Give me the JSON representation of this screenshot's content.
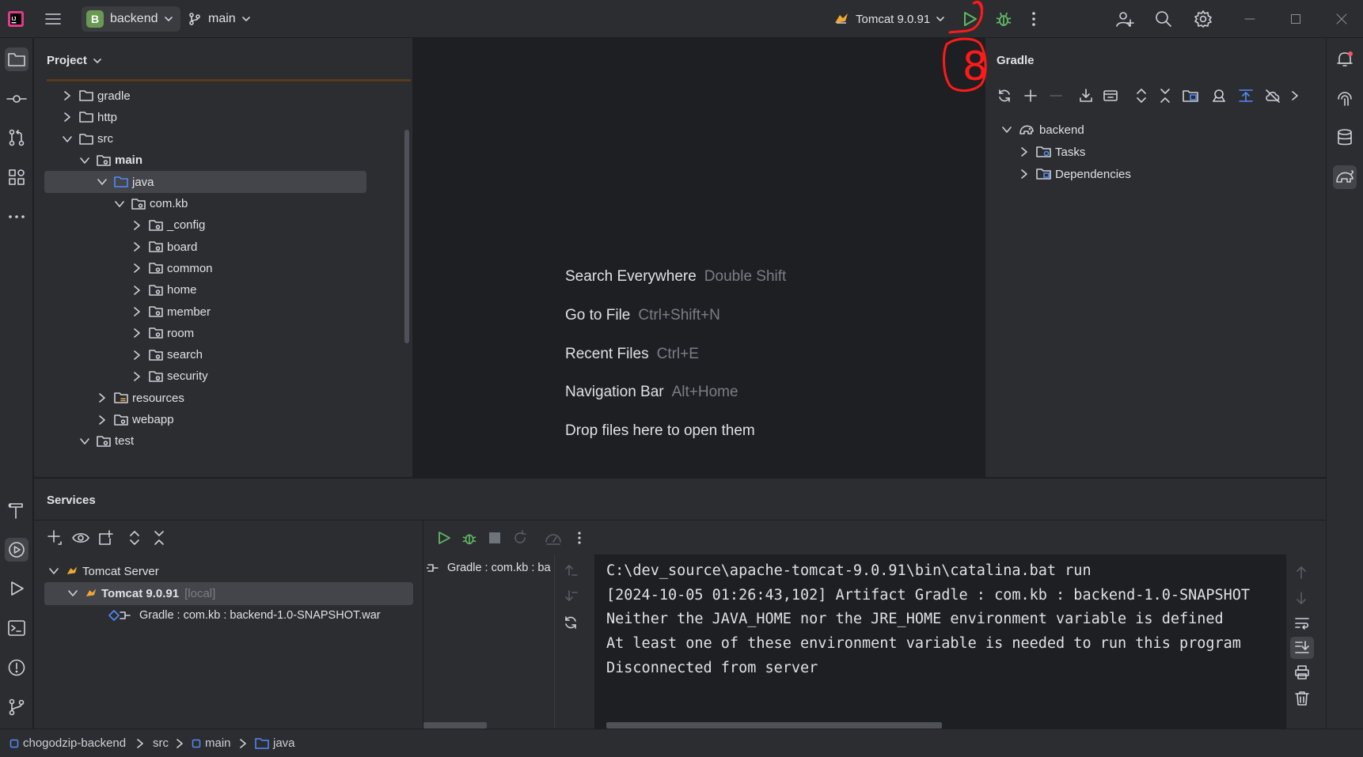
{
  "titlebar": {
    "project_initial": "B",
    "project_name": "backend",
    "branch": "main",
    "run_config": "Tomcat 9.0.91",
    "annotation_number": "8"
  },
  "left_stripe": [
    "folder-icon",
    "commit-icon",
    "pull-requests-icon",
    "structure-icon",
    "more-icon",
    "build-icon",
    "services-icon",
    "run-icon",
    "terminal-icon",
    "problems-icon",
    "git-icon"
  ],
  "right_stripe": [
    "notifications-icon",
    "ai-assistant-icon",
    "database-icon",
    "gradle-icon"
  ],
  "project_panel": {
    "title": "Project",
    "tree": [
      {
        "label": "gradle",
        "depth": 0,
        "expanded": false
      },
      {
        "label": "http",
        "depth": 0,
        "expanded": false
      },
      {
        "label": "src",
        "depth": 0,
        "expanded": true
      },
      {
        "label": "main",
        "depth": 1,
        "expanded": true,
        "bold": true
      },
      {
        "label": "java",
        "depth": 2,
        "expanded": true,
        "selected": true
      },
      {
        "label": "com.kb",
        "depth": 3,
        "expanded": true
      },
      {
        "label": "_config",
        "depth": 4,
        "expanded": false
      },
      {
        "label": "board",
        "depth": 4,
        "expanded": false
      },
      {
        "label": "common",
        "depth": 4,
        "expanded": false
      },
      {
        "label": "home",
        "depth": 4,
        "expanded": false
      },
      {
        "label": "member",
        "depth": 4,
        "expanded": false
      },
      {
        "label": "room",
        "depth": 4,
        "expanded": false
      },
      {
        "label": "search",
        "depth": 4,
        "expanded": false
      },
      {
        "label": "security",
        "depth": 4,
        "expanded": false
      },
      {
        "label": "resources",
        "depth": 2,
        "expanded": false
      },
      {
        "label": "webapp",
        "depth": 2,
        "expanded": false
      },
      {
        "label": "test",
        "depth": 1,
        "expanded": true
      }
    ]
  },
  "editor_hints": [
    {
      "action": "Search Everywhere",
      "shortcut": "Double Shift"
    },
    {
      "action": "Go to File",
      "shortcut": "Ctrl+Shift+N"
    },
    {
      "action": "Recent Files",
      "shortcut": "Ctrl+E"
    },
    {
      "action": "Navigation Bar",
      "shortcut": "Alt+Home"
    },
    {
      "action": "Drop files here to open them",
      "shortcut": ""
    }
  ],
  "gradle_panel": {
    "title": "Gradle",
    "tree": [
      {
        "label": "backend",
        "expanded": true
      },
      {
        "label": "Tasks",
        "expanded": false
      },
      {
        "label": "Dependencies",
        "expanded": false
      }
    ]
  },
  "services": {
    "title": "Services",
    "tree": {
      "server": "Tomcat Server",
      "instance": "Tomcat 9.0.91",
      "instance_tag": "[local]",
      "artifact": "Gradle : com.kb : backend-1.0-SNAPSHOT.war"
    },
    "deployment_item": "Gradle : com.kb : ba",
    "console_lines": [
      "C:\\dev_source\\apache-tomcat-9.0.91\\bin\\catalina.bat run",
      "[2024-10-05 01:26:43,102] Artifact Gradle : com.kb : backend-1.0-SNAPSHOT",
      "Neither the JAVA_HOME nor the JRE_HOME environment variable is defined",
      "At least one of these environment variable is needed to run this program",
      "Disconnected from server"
    ]
  },
  "status_bar": {
    "crumbs": [
      "chogodzip-backend",
      "src",
      "main",
      "java"
    ]
  },
  "colors": {
    "accent_green": "#5fb865",
    "annotation_red": "#ff1a1a",
    "panel_bg": "#2b2d30",
    "editor_bg": "#1e1f22",
    "muted_text": "#7a7e85"
  }
}
